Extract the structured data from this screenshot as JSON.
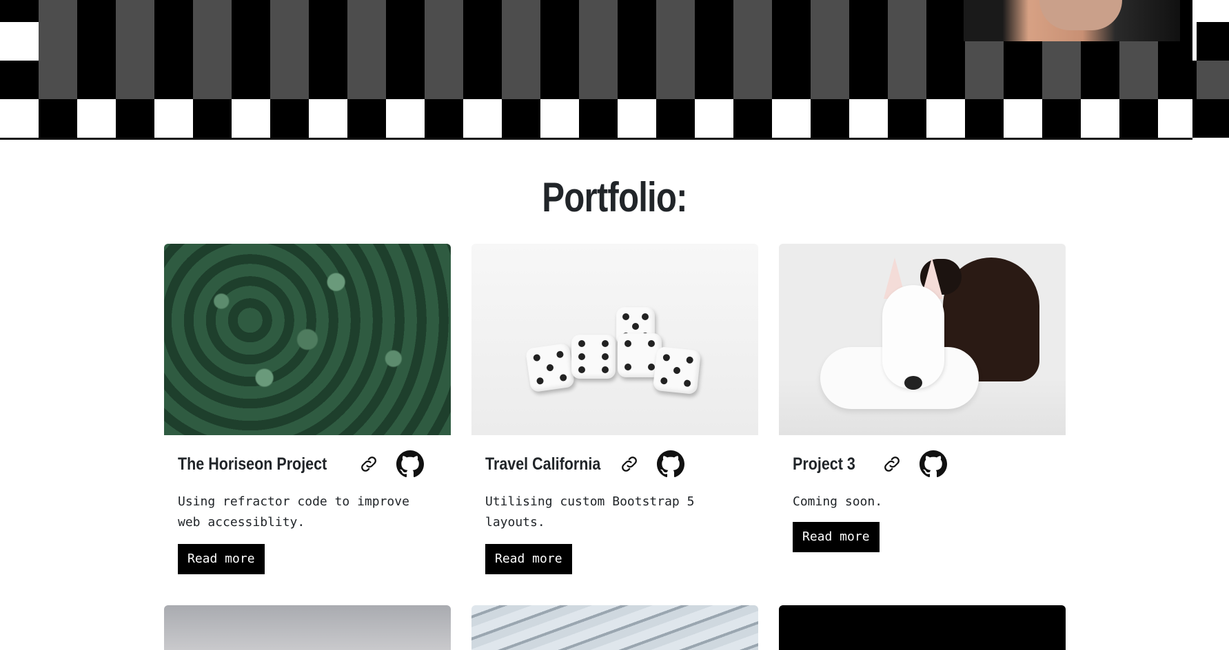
{
  "portfolio": {
    "title": "Portfolio:",
    "cards": [
      {
        "title": "The Horiseon Project",
        "description": "Using refractor code to improve web accessiblity.",
        "button": "Read more",
        "image": "clover-leaves-photo"
      },
      {
        "title": "Travel California",
        "description": "Utilising custom Bootstrap 5 layouts.",
        "button": "Read more",
        "image": "white-dice-photo"
      },
      {
        "title": "Project 3",
        "description": "Coming soon.",
        "button": "Read more",
        "image": "dog-and-cat-photo"
      }
    ],
    "next_row_images": [
      "sky-photo",
      "rope-photo",
      "black-placeholder"
    ]
  },
  "icons": {
    "link": "link-icon",
    "github": "github-icon"
  },
  "colors": {
    "text": "#212529",
    "button_bg": "#000000",
    "button_text": "#ffffff",
    "checker_dark": "#000000",
    "checker_grey": "#4d4d4d"
  }
}
